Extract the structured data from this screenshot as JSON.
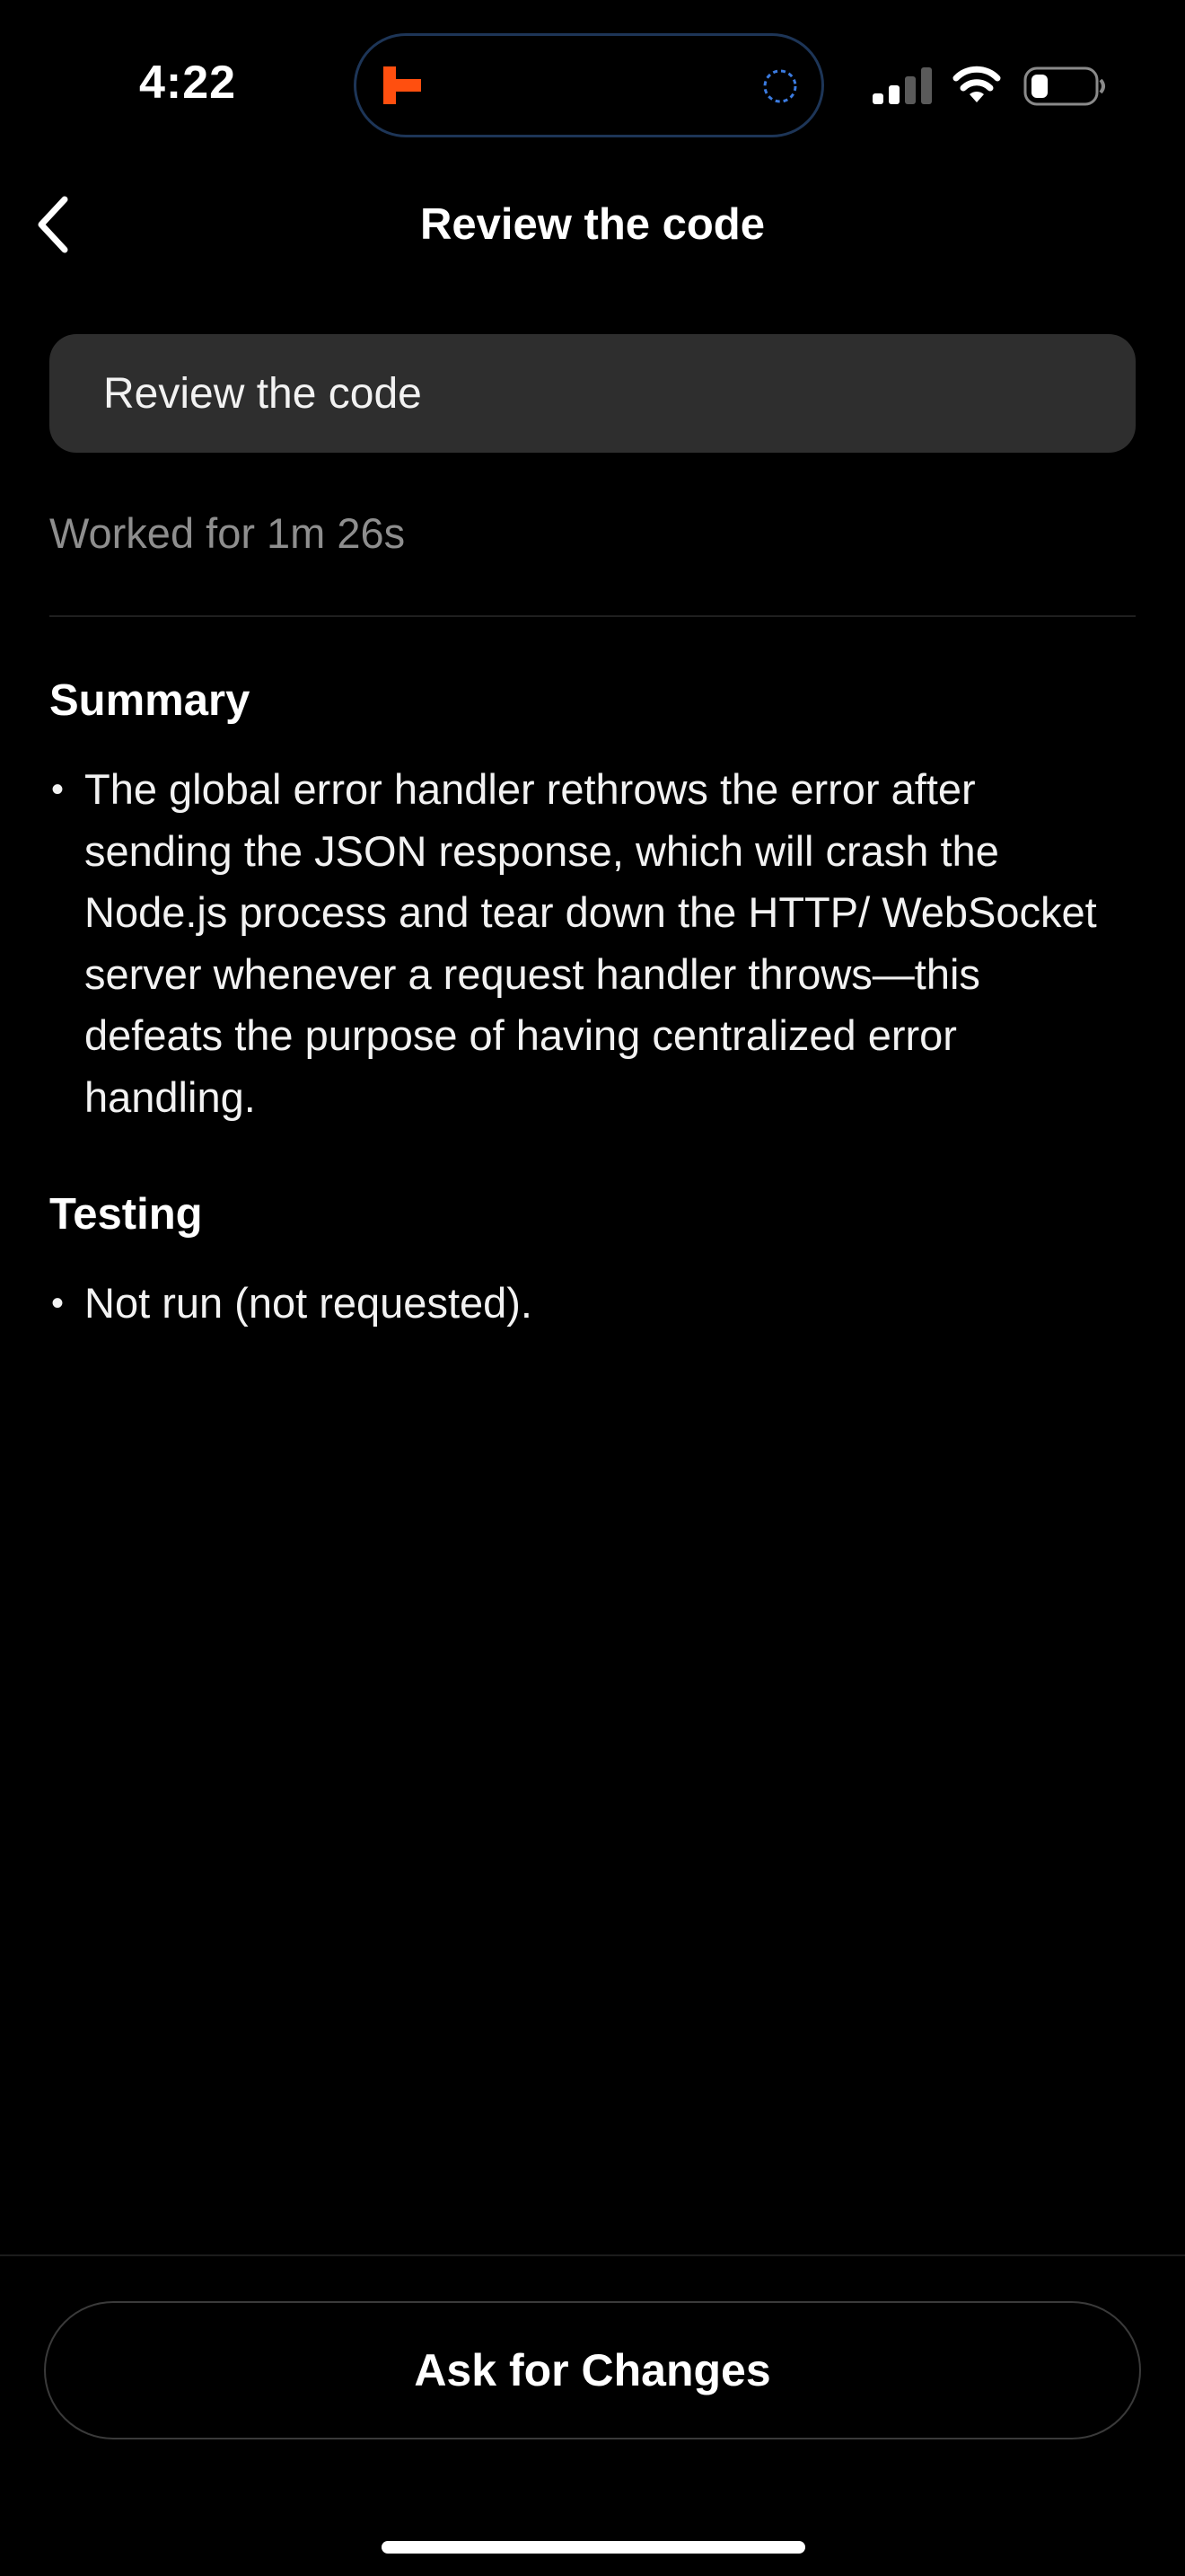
{
  "status_bar": {
    "time": "4:22",
    "app_icon": "cursor-logo-icon",
    "activity_icon": "progress-spinner-icon",
    "signal_icon": "cellular-signal-icon",
    "wifi_icon": "wifi-icon",
    "battery_icon": "battery-icon",
    "accent_color": "#ff4f0f",
    "island_border_color": "#1d3557"
  },
  "header": {
    "back_icon": "chevron-left-icon",
    "title": "Review the code"
  },
  "prompt": {
    "text": "Review the code"
  },
  "worked_for": "Worked for 1m 26s",
  "sections": [
    {
      "heading": "Summary",
      "bullets": [
        "The global error handler rethrows the error after sending the JSON response, which will crash the Node.js process and tear down the HTTP/ WebSocket server whenever a request handler throws—this defeats the purpose of having centralized error handling."
      ]
    },
    {
      "heading": "Testing",
      "bullets": [
        "Not run (not requested)."
      ]
    }
  ],
  "footer": {
    "ask_button_label": "Ask for Changes"
  }
}
